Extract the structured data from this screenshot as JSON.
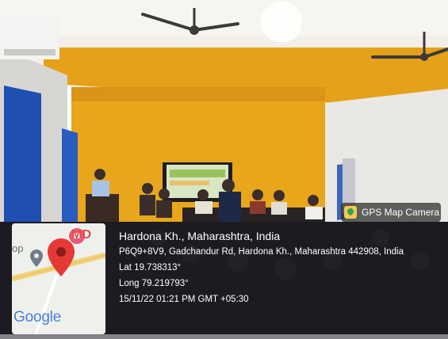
{
  "overlay": {
    "app_badge": "GPS Map Camera",
    "map": {
      "marker_text": "MD",
      "side_text": "op",
      "brand": "Google"
    },
    "location_title": "Hardona Kh., Maharashtra, India",
    "address": "P6Q9+8V9, Gadchandur Rd, Hardona Kh., Maharashtra 442908, India",
    "lat": "Lat 19.738313°",
    "long": "Long 79.219793°",
    "timestamp": "15/11/22 01:21 PM GMT +05:30"
  },
  "colors": {
    "wall_yellow": "#e9a51e",
    "curtain_blue": "#2357b8",
    "ceiling": "#f4f1ea",
    "floor_dark": "#1c1a1c",
    "pin_red": "#e53935"
  }
}
